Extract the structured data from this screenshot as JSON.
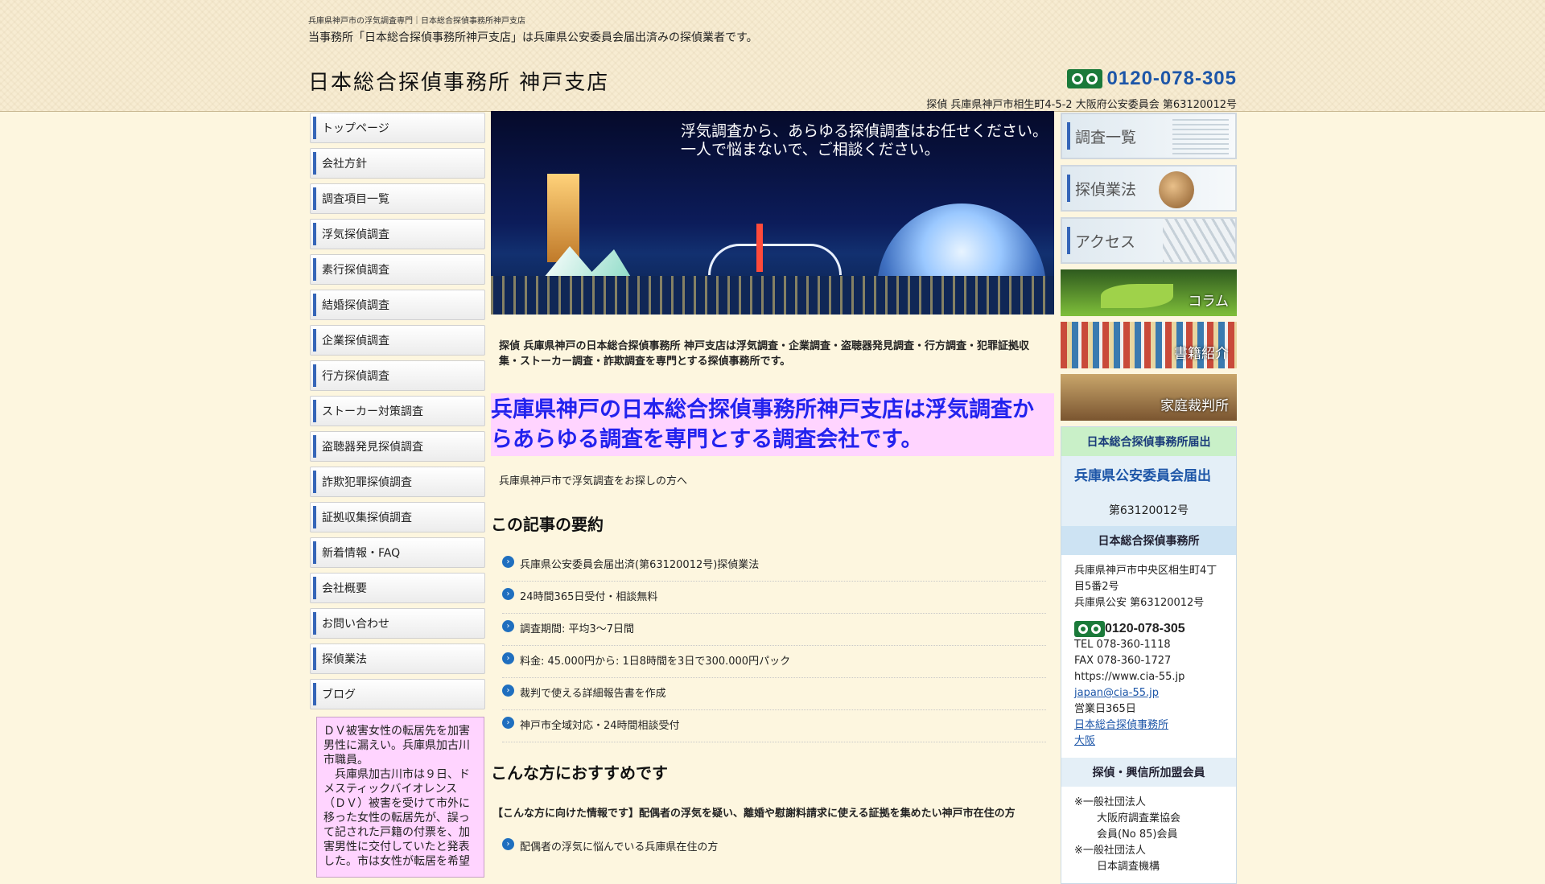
{
  "header": {
    "small_text": "兵庫県神戸市の浮気調査専門｜日本総合探偵事務所神戸支店",
    "description": "当事務所「日本総合探偵事務所神戸支店」は兵庫県公安委員会届出済みの探偵業者です。",
    "title": "日本総合探偵事務所 神戸支店",
    "phone": "0120-078-305",
    "address": "探偵 兵庫県神戸市相生町4-5-2 大阪府公安委員会 第63120012号"
  },
  "leftnav": {
    "items": [
      "トップページ",
      "会社方針",
      "調査項目一覧",
      "浮気探偵調査",
      "素行探偵調査",
      "結婚探偵調査",
      "企業探偵調査",
      "行方探偵調査",
      "ストーカー対策調査",
      "盗聴器発見探偵調査",
      "詐欺犯罪探偵調査",
      "証拠収集探偵調査",
      "新着情報・FAQ",
      "会社概要",
      "お問い合わせ",
      "探偵業法",
      "ブログ"
    ],
    "notice": "ＤＶ被害女性の転居先を加害男性に漏えい。兵庫県加古川市職員。\n　兵庫県加古川市は９日、ドメスティックバイオレンス（ＤＶ）被害を受けて市外に移った女性の転居先が、誤って記された戸籍の付票を、加害男性に交付していたと発表した。市は女性が転居を希望"
  },
  "main": {
    "hero_caption_1": "浮気調査から、あらゆる探偵調査はお任せください。",
    "hero_caption_2": "一人で悩まないで、ご相談ください。",
    "intro": "探偵 兵庫県神戸の日本総合探偵事務所 神戸支店は浮気調査・企業調査・盗聴器発見調査・行方調査・犯罪証拠収集・ストーカー調査・詐欺調査を専門とする探偵事務所です。",
    "headline": "兵庫県神戸の日本総合探偵事務所神戸支店は浮気調査からあらゆる調査を専門とする調査会社です。",
    "sub_text": "兵庫県神戸市で浮気調査をお探しの方へ",
    "summary_title": "この記事の要約",
    "summary_items": [
      "兵庫県公安委員会届出済(第63120012号)探偵業法",
      "24時間365日受付・相談無料",
      "調査期間: 平均3～7日間",
      "料金: 45.000円から: 1日8時間を3日で300.000円パック",
      "裁判で使える詳細報告書を作成",
      "神戸市全域対応・24時間相談受付"
    ],
    "recommend_title": "こんな方におすすめです",
    "recommend_intro": "【こんな方に向けた情報です】配偶者の浮気を疑い、離婚や慰謝料請求に使える証拠を集めたい神戸市在住の方",
    "recommend_items": [
      "配偶者の浮気に悩んでいる兵庫県在住の方"
    ]
  },
  "right": {
    "banners": [
      "調査一覧",
      "探偵業法",
      "アクセス",
      "コラム",
      "書籍紹介",
      "家庭裁判所"
    ],
    "reg_head": "日本総合探偵事務所届出",
    "reg_title": "兵庫県公安委員会届出",
    "reg_number": "第63120012号",
    "office_head": "日本総合探偵事務所",
    "office_address": "兵庫県神戸市中央区相生町4丁目5番2号",
    "office_license": "兵庫県公安 第63120012号",
    "office_phone": "0120-078-305",
    "tel": "TEL 078-360-1118",
    "fax": "FAX 078-360-1727",
    "url": "https://www.cia-55.jp",
    "email": "japan@cia-55.jp",
    "business_days": "営業日365日",
    "link_main": "日本総合探偵事務所",
    "link_osaka": "大阪",
    "member_head": "探偵・興信所加盟会員",
    "member_1": "※一般社団法人",
    "member_1_name": "大阪府調査業協会",
    "member_1_no": "会員(No 85)会員",
    "member_2": "※一般社団法人",
    "member_2_name": "日本調査機構"
  },
  "colors": {
    "accent_blue": "#1d56a8",
    "headline_bg": "#ffd4ff",
    "freedial_green": "#1b7a3a"
  }
}
